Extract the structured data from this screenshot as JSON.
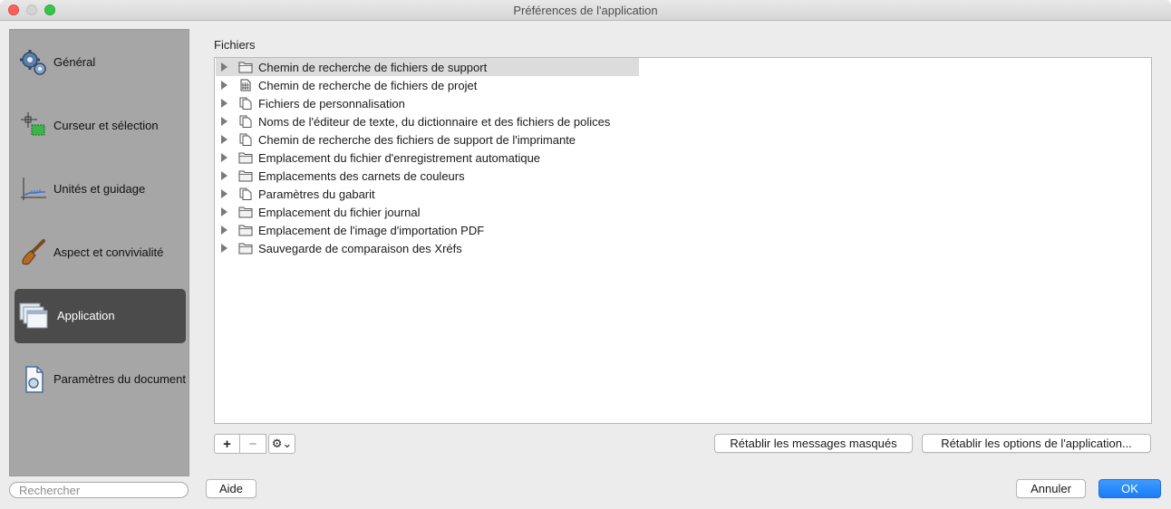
{
  "window": {
    "title": "Préférences de l'application"
  },
  "sidebar": {
    "items": [
      {
        "label": "Général",
        "icon": "gears-icon"
      },
      {
        "label": "Curseur et sélection",
        "icon": "cursor-selection-icon"
      },
      {
        "label": "Unités et guidage",
        "icon": "units-ruler-icon"
      },
      {
        "label": "Aspect et convivialité",
        "icon": "paintbrush-icon"
      },
      {
        "label": "Application",
        "icon": "windows-stack-icon",
        "active": true
      },
      {
        "label": "Paramètres du document",
        "icon": "document-settings-icon"
      }
    ]
  },
  "search": {
    "placeholder": "Rechercher"
  },
  "main": {
    "section_label": "Fichiers",
    "tree": [
      {
        "label": "Chemin de recherche de fichiers de support",
        "icon": "folder-icon",
        "selected": true
      },
      {
        "label": "Chemin de recherche de fichiers de projet",
        "icon": "project-file-icon"
      },
      {
        "label": "Fichiers de personnalisation",
        "icon": "document-stack-icon"
      },
      {
        "label": "Noms de l'éditeur de texte, du dictionnaire et des fichiers de polices",
        "icon": "document-stack-icon"
      },
      {
        "label": "Chemin de recherche des fichiers de support de l'imprimante",
        "icon": "document-stack-icon"
      },
      {
        "label": "Emplacement du fichier d'enregistrement automatique",
        "icon": "folder-icon"
      },
      {
        "label": "Emplacements des carnets de couleurs",
        "icon": "folder-icon"
      },
      {
        "label": "Paramètres du gabarit",
        "icon": "document-stack-icon"
      },
      {
        "label": "Emplacement du fichier journal",
        "icon": "folder-icon"
      },
      {
        "label": "Emplacement de l'image d'importation PDF",
        "icon": "folder-icon"
      },
      {
        "label": "Sauvegarde de comparaison des Xréfs",
        "icon": "folder-icon"
      }
    ],
    "add_label": "+",
    "remove_label": "−",
    "gear_label": "⚙⌄",
    "reset_messages_label": "Rétablir les messages masqués",
    "reset_options_label": "Rétablir les options de l'application..."
  },
  "footer": {
    "help_label": "Aide",
    "cancel_label": "Annuler",
    "ok_label": "OK"
  },
  "colors": {
    "accent": "#1a7cf6",
    "sidebar_bg": "#a6a6a6",
    "sidebar_active": "#4b4b4b"
  }
}
